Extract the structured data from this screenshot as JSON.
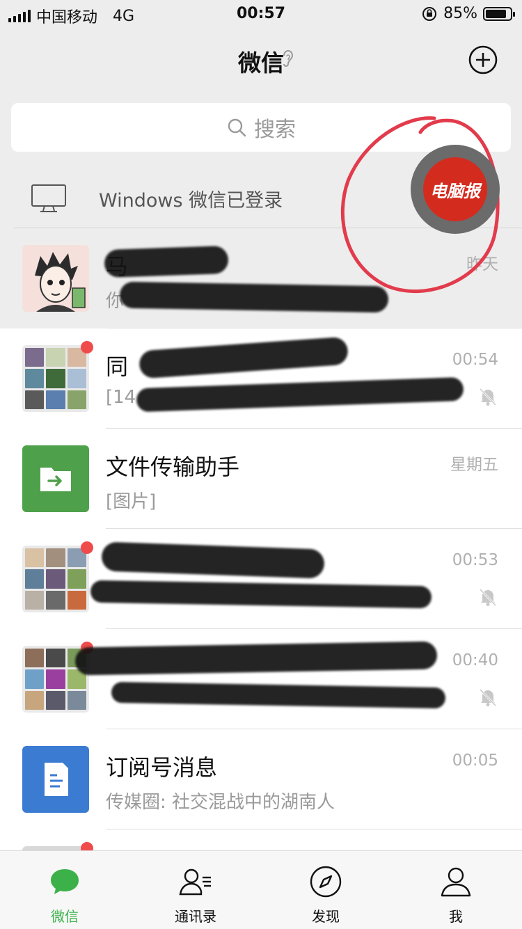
{
  "status_bar": {
    "carrier": "中国移动",
    "network": "4G",
    "time": "00:57",
    "battery": "85%",
    "battery_level": 0.85
  },
  "header": {
    "title": "微信"
  },
  "search": {
    "placeholder": "搜索"
  },
  "login_notice": {
    "label": "Windows 微信已登录"
  },
  "watermark": {
    "text": "电脑报"
  },
  "chats": [
    {
      "name": "马",
      "preview": "你",
      "time": "昨天",
      "pinned": true
    },
    {
      "name": "同",
      "preview": "[14",
      "time": "00:54",
      "muted": true,
      "unread_dot": true
    },
    {
      "name": "文件传输助手",
      "preview": "[图片]",
      "time": "星期五"
    },
    {
      "name": "",
      "preview": "",
      "time": "00:53",
      "muted": true,
      "unread_dot": true
    },
    {
      "name": "",
      "preview": "",
      "time": "00:40",
      "muted": true,
      "unread_dot": true
    },
    {
      "name": "订阅号消息",
      "preview": "传媒圈: 社交混战中的湖南人",
      "time": "00:05"
    }
  ],
  "tabs": [
    {
      "label": "微信",
      "active": true
    },
    {
      "label": "通讯录"
    },
    {
      "label": "发现"
    },
    {
      "label": "我"
    }
  ],
  "colors": {
    "accent": "#3cb14a",
    "file_helper": "#4ea14a",
    "subscription": "#3b7bd1",
    "unread": "#f04b4b",
    "annotation": "#e23b4c"
  }
}
